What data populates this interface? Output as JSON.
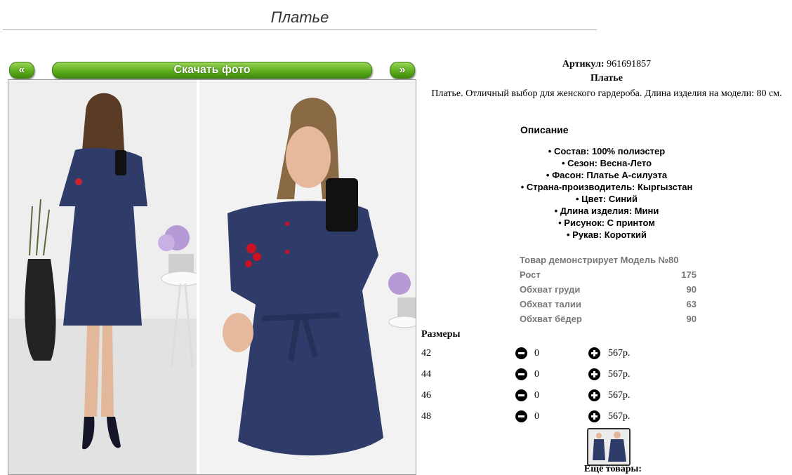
{
  "page": {
    "title": "Платье"
  },
  "nav": {
    "prev": "«",
    "next": "»",
    "download": "Скачать фото"
  },
  "product": {
    "sku_label": "Артикул:",
    "sku": "961691857",
    "name": "Платье",
    "description": "Платье. Отличный выбор для женского гардероба. Длина изделия на модели: 80 см.",
    "desc_heading": "Описание",
    "attributes": [
      "• Состав: 100% полиэстер",
      "• Сезон: Весна-Лето",
      "• Фасон: Платье А-силуэта",
      "• Страна-производитель: Кыргызстан",
      "• Цвет: Синий",
      "• Длина изделия: Мини",
      "• Рисунок: С принтом",
      "• Рукав: Короткий"
    ]
  },
  "model": {
    "heading": "Товар демонстрирует Модель №80",
    "rows": [
      {
        "label": "Рост",
        "value": "175"
      },
      {
        "label": "Обхват груди",
        "value": "90"
      },
      {
        "label": "Обхват талии",
        "value": "63"
      },
      {
        "label": "Обхват бёдер",
        "value": "90"
      }
    ]
  },
  "sizes": {
    "heading": "Размеры",
    "rows": [
      {
        "size": "42",
        "qty": "0",
        "price": "567р."
      },
      {
        "size": "44",
        "qty": "0",
        "price": "567р."
      },
      {
        "size": "46",
        "qty": "0",
        "price": "567р."
      },
      {
        "size": "48",
        "qty": "0",
        "price": "567р."
      }
    ]
  },
  "more": {
    "label": "Ещё товары:"
  },
  "colors": {
    "button_green": "#5fae1c",
    "dress_blue": "#2f3c6a"
  }
}
